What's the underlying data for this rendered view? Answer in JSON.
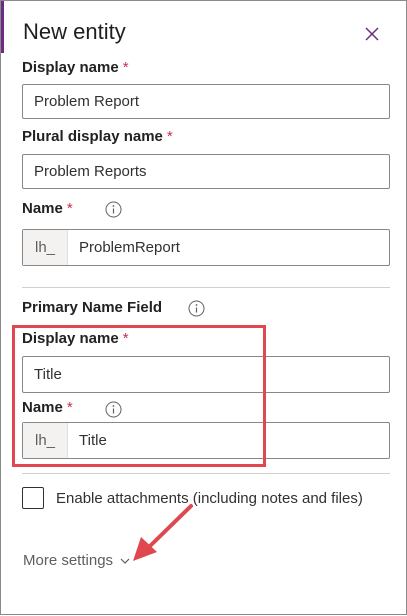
{
  "panel": {
    "title": "New entity",
    "close_icon": "close-icon"
  },
  "display_name": {
    "label": "Display name",
    "required_mark": "*",
    "value": "Problem Report"
  },
  "plural_display_name": {
    "label": "Plural display name",
    "required_mark": "*",
    "value": "Problem Reports"
  },
  "name": {
    "label": "Name",
    "required_mark": "*",
    "prefix": "lh_",
    "value": "ProblemReport",
    "info_icon": "info-icon"
  },
  "primary_name_field": {
    "heading": "Primary Name Field",
    "info_icon": "info-icon",
    "display_name": {
      "label": "Display name",
      "required_mark": "*",
      "value": "Title"
    },
    "name": {
      "label": "Name",
      "required_mark": "*",
      "prefix": "lh_",
      "value": "Title"
    }
  },
  "enable_attachments": {
    "label": "Enable attachments (including notes and files)",
    "checked": false
  },
  "more_settings": {
    "label": "More settings",
    "icon": "chevron-down-icon"
  },
  "colors": {
    "accent": "#6b2c83",
    "required": "#c4314b",
    "highlight": "#e0484f"
  }
}
